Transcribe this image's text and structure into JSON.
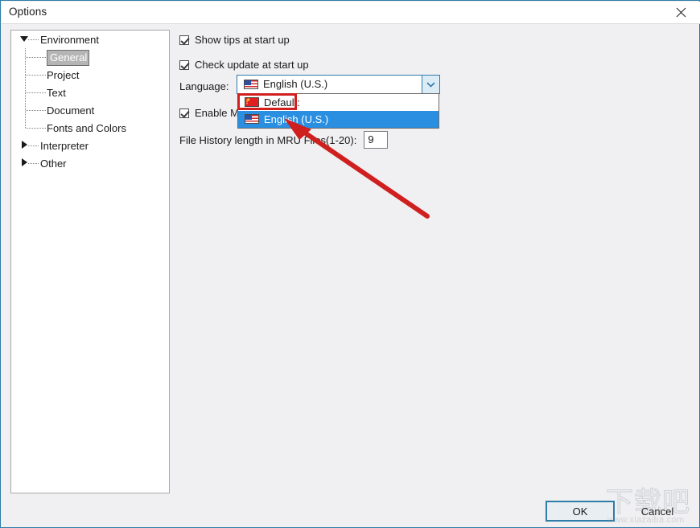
{
  "window": {
    "title": "Options",
    "close_icon": "close-icon"
  },
  "tree": {
    "nodes": [
      {
        "label": "Environment",
        "level": "root",
        "expander": "down",
        "selected": false
      },
      {
        "label": "General",
        "level": "child",
        "expander": "none",
        "selected": true
      },
      {
        "label": "Project",
        "level": "child",
        "expander": "none",
        "selected": false
      },
      {
        "label": "Text",
        "level": "child",
        "expander": "none",
        "selected": false
      },
      {
        "label": "Document",
        "level": "child",
        "expander": "none",
        "selected": false
      },
      {
        "label": "Fonts and Colors",
        "level": "child",
        "expander": "none",
        "selected": false
      },
      {
        "label": "Interpreter",
        "level": "root",
        "expander": "right",
        "selected": false
      },
      {
        "label": "Other",
        "level": "root",
        "expander": "right",
        "selected": false
      }
    ]
  },
  "options": {
    "show_tips": {
      "label": "Show tips at start up",
      "checked": true
    },
    "check_update": {
      "label": "Check update at start up",
      "checked": true
    },
    "enable_m": {
      "label": "Enable M",
      "checked": true
    },
    "language": {
      "label": "Language:",
      "value": "English (U.S.)",
      "flag_icon": "flag-us-icon",
      "dropdown_icon": "chevron-down-icon",
      "items": [
        {
          "label": "Default:",
          "flag_icon": "flag-cn-icon",
          "selected": false,
          "highlighted": true
        },
        {
          "label": "English (U.S.)",
          "flag_icon": "flag-us-icon",
          "selected": true,
          "highlighted": false
        }
      ]
    },
    "mru": {
      "label": "File History length in MRU Files(1-20):",
      "value": "9"
    }
  },
  "footer": {
    "ok_label": "OK",
    "cancel_label": "Cancel"
  },
  "watermark": {
    "brand": "下载吧",
    "url": "www.xiazaiba.com"
  },
  "colors": {
    "accent": "#2e7ca8",
    "selection": "#2a8fe0",
    "annotation": "#cf1f1f",
    "tree_selection": "#b5b5b5"
  }
}
